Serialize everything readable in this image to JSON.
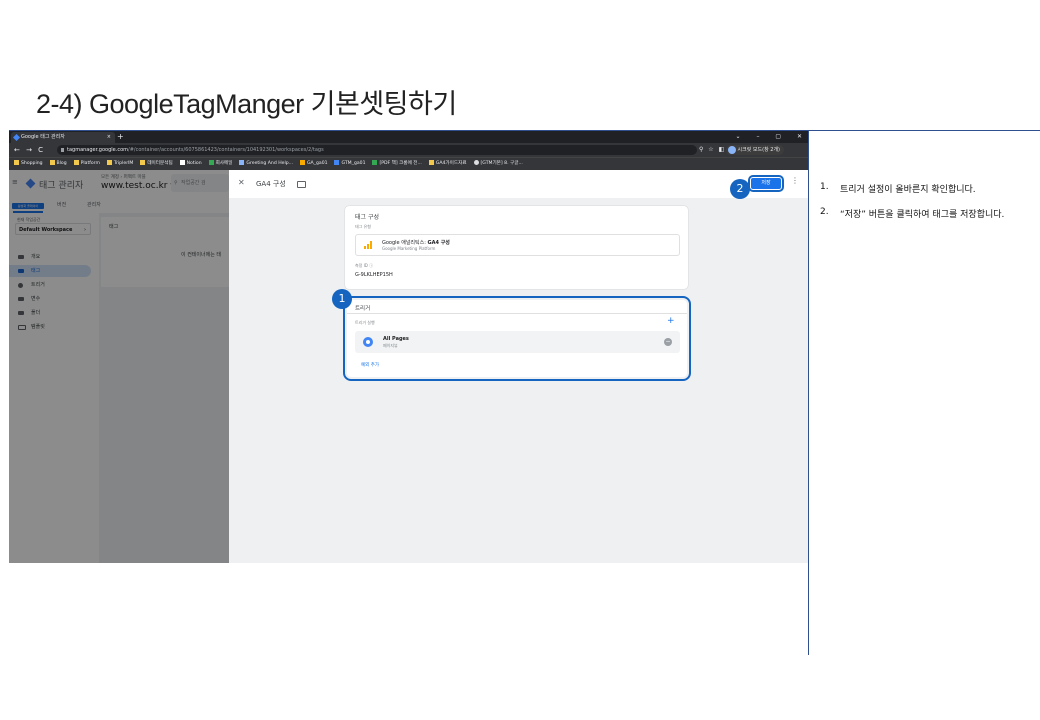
{
  "slide": {
    "title": "2-4) GoogleTagManger 기본셋팅하기",
    "instructions": [
      {
        "number": "1.",
        "text": "트리거 설정이 올바른지 확인합니다."
      },
      {
        "number": "2.",
        "text": "“저장” 버튼을 클릭하여 태그를 저장합니다."
      }
    ],
    "callouts": [
      "1",
      "2"
    ],
    "accent_color": "#1565c0"
  },
  "browser": {
    "tab_title": "Google 태그 관리자",
    "tab_close": "×",
    "new_tab": "+",
    "window_controls": "⌄ – ▢ ✕",
    "nav_buttons": "← → C",
    "url_host": "tagmanager.google.com",
    "url_path": "/#/container/accounts/6075861423/containers/104192301/workspaces/2/tags",
    "address_icons": "⚲ ☆ ◧",
    "profile_label": "시크릿 모드(창 2개)",
    "bookmarks": [
      "Shopping",
      "Blog",
      "Platform",
      "TriplerIM",
      "데이터분석팀",
      "Notion",
      "회사메일",
      "Greeting And Help...",
      "GA_ga01",
      "GTM_ga01",
      "[PDF 책] 크롬에 전...",
      "GA4가이드자료",
      "[GTM기본] 8. 구글..."
    ]
  },
  "gtm": {
    "menu_icon": "≡",
    "product_name": "태그 관리자",
    "account_path": "모든 계정 › 퍼펙트 마블",
    "container_name": "www.test.oc.kr ▾",
    "search_placeholder": "작업공간 검",
    "workspace_chip": "활성화 플레이어",
    "subnav_tabs": [
      "버전",
      "관리자"
    ],
    "workspace_label": "현재 작업공간",
    "workspace_name": "Default Workspace",
    "workspace_arrow": "›",
    "sidebar_items": [
      "개요",
      "태그",
      "트리거",
      "변수",
      "폴더",
      "템플릿"
    ],
    "tags_title": "태그",
    "tags_empty_text": "이 컨테이너에는 태"
  },
  "sheet": {
    "close_icon": "✕",
    "tag_title": "GA4 구성",
    "save_label": "저장",
    "more_icon": "⋮",
    "config": {
      "section_title": "태그 구성",
      "type_label": "태그 유형",
      "type_name_prefix": "Google 애널리틱스: ",
      "type_name_bold": "GA4 구성",
      "type_vendor": "Google Marketing Platform",
      "measurement_label": "측정 ID ⓘ",
      "measurement_id": "G-9LKLHEP15H"
    },
    "triggering": {
      "section_title": "트리거",
      "firing_label": "트리거 실행",
      "add_icon": "+",
      "trigger_name": "All Pages",
      "trigger_type": "페이지뷰",
      "remove_icon": "−",
      "exception_link": "예외 추가"
    }
  }
}
